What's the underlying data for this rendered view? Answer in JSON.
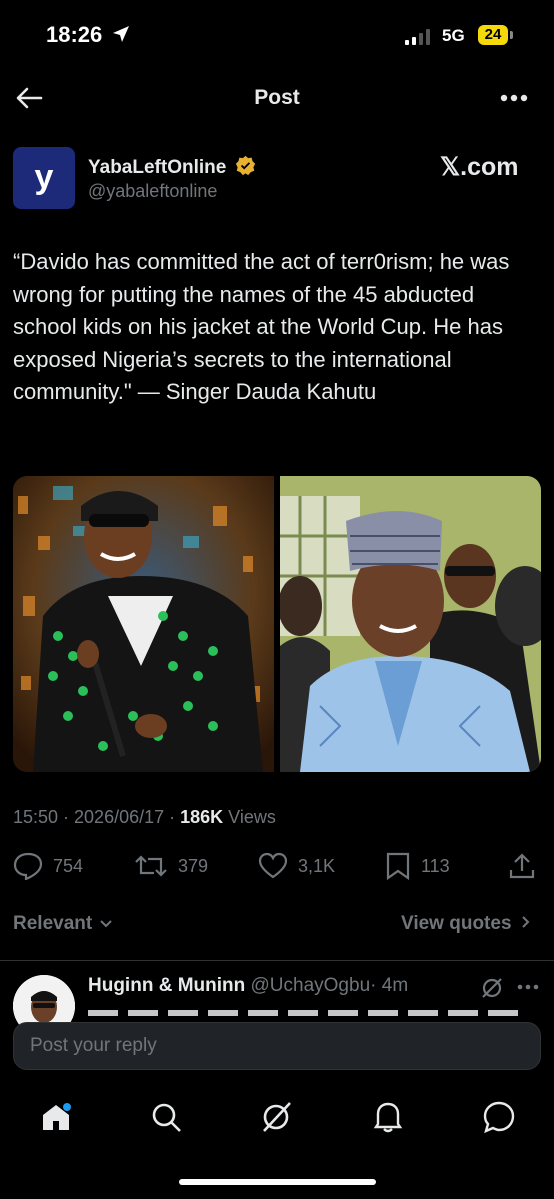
{
  "status_bar": {
    "time": "18:26",
    "network": "5G",
    "battery": "24"
  },
  "header": {
    "title": "Post",
    "back_icon": "arrow-left-icon",
    "more_icon": "more-icon"
  },
  "tweet": {
    "author_name": "YabaLeftOnline",
    "author_handle": "@yabaleftonline",
    "avatar_letter": "y",
    "source": "𝕏.com",
    "text": "“Davido has committed the act of terr0rism; he was wrong for putting the names of the 45 abducted school kids on his jacket at the World Cup. He has exposed Nigeria’s secrets to the international community.\" — Singer Dauda Kahutu",
    "time": "15:50 · 2026/06/17 · ",
    "views_count": "186K",
    "views_label": " Views",
    "replies": "754",
    "reposts": "379",
    "likes": "3,1K",
    "bookmarks": "113"
  },
  "replies_section": {
    "sort_label": "Relevant",
    "view_quotes": "View quotes",
    "first_reply": {
      "name": "Huginn & Muninn",
      "handle": "@UchayOgbu",
      "age": "· 4m"
    }
  },
  "reply_box": {
    "placeholder": "Post your reply"
  },
  "colors": {
    "accent": "#1d9bf0",
    "verified": "#e8b230",
    "background": "#000000",
    "muted": "#71767b"
  }
}
